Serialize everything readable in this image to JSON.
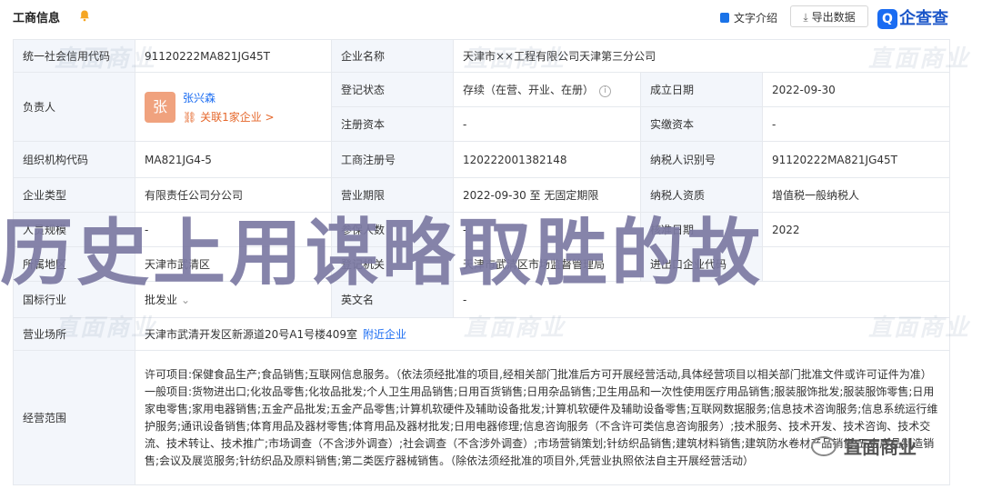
{
  "header": {
    "title": "工商信息",
    "intro_label": "文字介绍",
    "export_label": "导出数据",
    "logo_text": "企查查"
  },
  "watermark": "直面商业",
  "overlay_text": "历史上用谋略取胜的故",
  "brand_text": "直面商业",
  "rows": {
    "credit_code": {
      "label": "统一社会信用代码",
      "value": "91120222MA821JG45T"
    },
    "company_name": {
      "label": "企业名称",
      "value": "天津市××工程有限公司天津第三分公司"
    },
    "legal_person": {
      "label": "负责人",
      "avatar": "张",
      "name": "张兴森",
      "related": "关联1家企业 >"
    },
    "reg_status": {
      "label": "登记状态",
      "value": "存续（在营、开业、在册）"
    },
    "est_date": {
      "label": "成立日期",
      "value": "2022-09-30"
    },
    "reg_capital": {
      "label": "注册资本",
      "value": "-"
    },
    "paid_capital": {
      "label": "实缴资本",
      "value": "-"
    },
    "org_code": {
      "label": "组织机构代码",
      "value": "MA821JG4-5"
    },
    "reg_no": {
      "label": "工商注册号",
      "value": "120222001382148"
    },
    "taxpayer_id": {
      "label": "纳税人识别号",
      "value": "91120222MA821JG45T"
    },
    "company_type": {
      "label": "企业类型",
      "value": "有限责任公司分公司"
    },
    "business_term": {
      "label": "营业期限",
      "value": "2022-09-30 至 无固定期限"
    },
    "taxpayer_qual": {
      "label": "纳税人资质",
      "value": "增值税一般纳税人"
    },
    "staff_size": {
      "label": "人员规模",
      "value": "-"
    },
    "insured": {
      "label": "参保人数",
      "value": "-"
    },
    "approval_date": {
      "label": "核准日期",
      "value": "2022"
    },
    "region": {
      "label": "所属地区",
      "value": "天津市武清区"
    },
    "authority": {
      "label": "登记机关",
      "value": "天津市武清区市场监督管理局"
    },
    "import_export": {
      "label": "进出口企业代码",
      "value": ""
    },
    "industry": {
      "label": "国标行业",
      "value": "批发业"
    },
    "english_name": {
      "label": "英文名",
      "value": "-"
    },
    "address": {
      "label": "营业场所",
      "value": "天津市武清开发区新源道20号A1号楼409室",
      "link": "附近企业"
    },
    "scope": {
      "label": "经营范围",
      "value": "许可项目:保健食品生产;食品销售;互联网信息服务。（依法须经批准的项目,经相关部门批准后方可开展经营活动,具体经营项目以相关部门批准文件或许可证件为准）一般项目:货物进出口;化妆品零售;化妆品批发;个人卫生用品销售;日用百货销售;日用杂品销售;卫生用品和一次性使用医疗用品销售;服装服饰批发;服装服饰零售;日用家电零售;家用电器销售;五金产品批发;五金产品零售;计算机软硬件及辅助设备批发;计算机软硬件及辅助设备零售;互联网数据服务;信息技术咨询服务;信息系统运行维护服务;通讯设备销售;体育用品及器材零售;体育用品及器材批发;日用电器修理;信息咨询服务（不含许可类信息咨询服务）;技术服务、技术开发、技术咨询、技术交流、技术转让、技术推广;市场调查（不含涉外调查）;社会调查（不含涉外调查）;市场营销策划;针纺织品销售;建筑材料销售;建筑防水卷材产品销售;五金产品制造销售;会议及展览服务;针纺织品及原料销售;第二类医疗器械销售。（除依法须经批准的项目外,凭营业执照依法自主开展经营活动）"
    }
  }
}
